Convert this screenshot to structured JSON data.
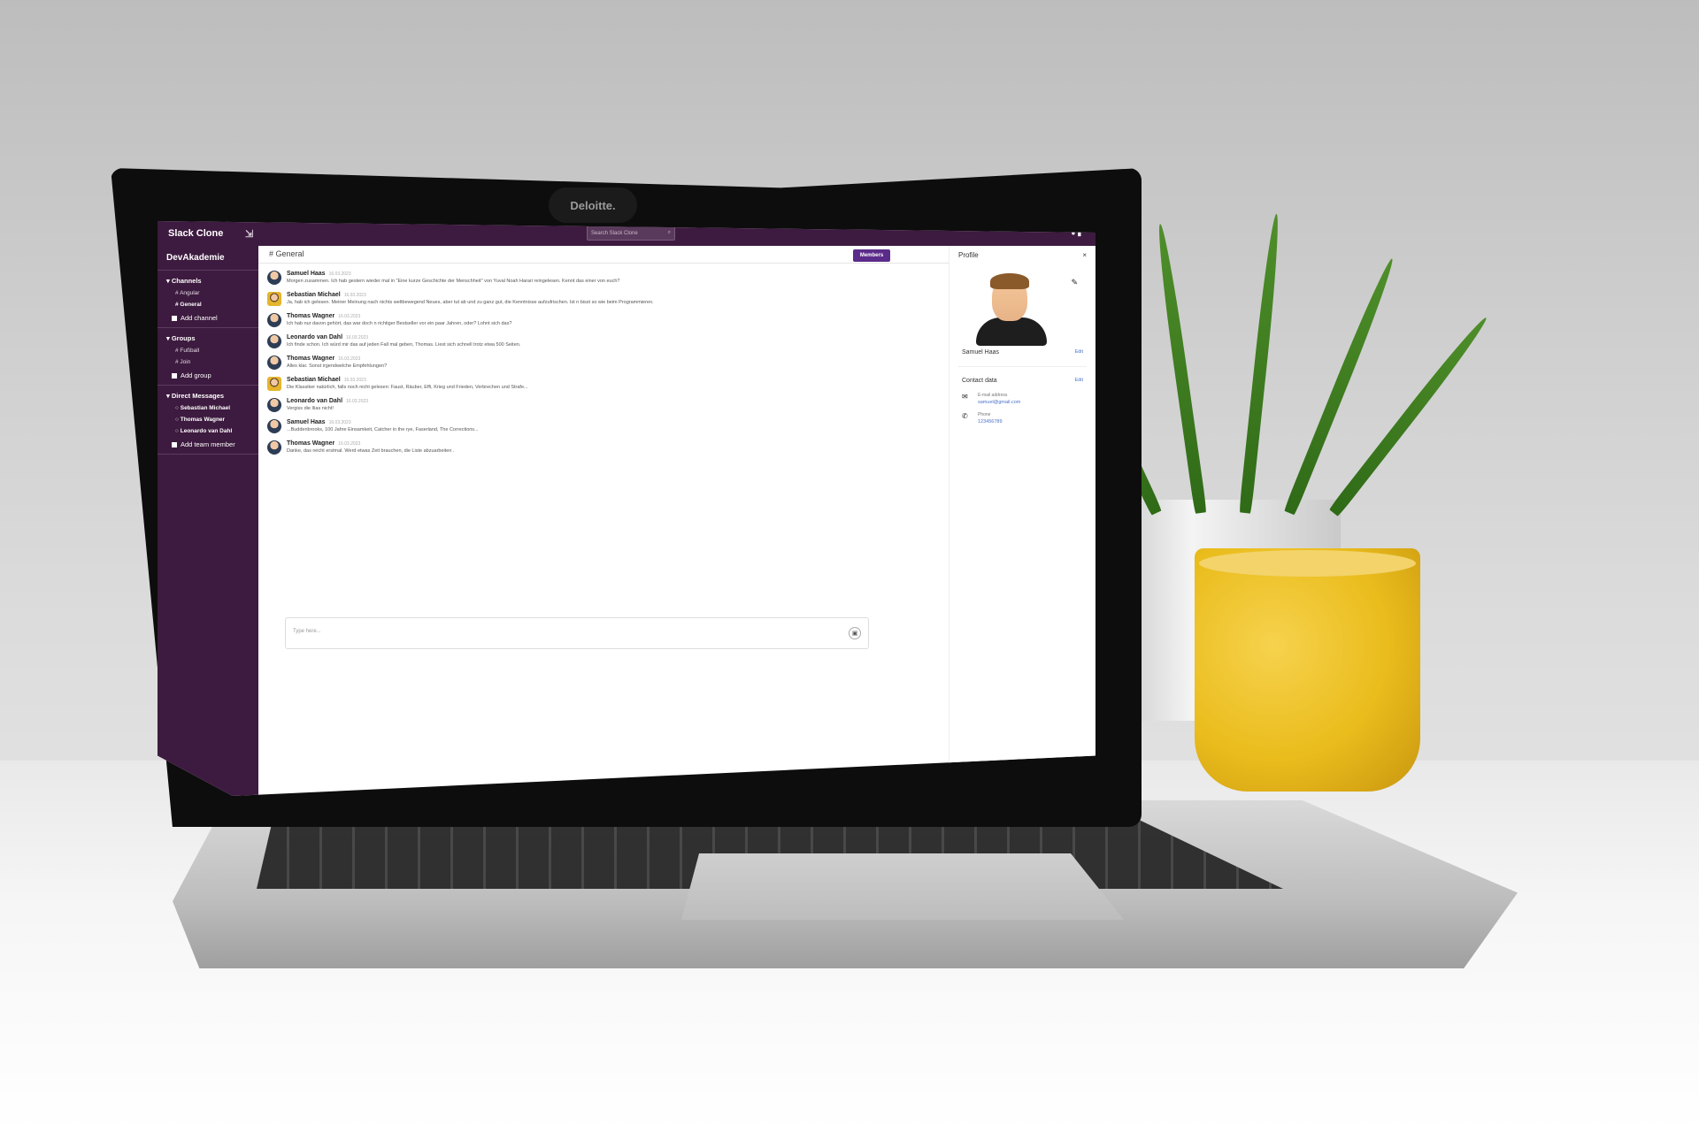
{
  "bezel": {
    "brand": "Deloitte."
  },
  "app": {
    "title": "Slack Clone",
    "collapse_icon": "collapse-arrows",
    "search_placeholder": "Search Slack Clone",
    "workspace": "DevAkademie"
  },
  "sidebar": {
    "channels_label": "▾ Channels",
    "channels": [
      "Angular",
      "General"
    ],
    "add_channel": "Add channel",
    "groups_label": "▾ Groups",
    "groups": [
      "Fußball",
      "Join"
    ],
    "add_group": "Add group",
    "dm_label": "▾ Direct Messages",
    "dms": [
      "Sebastian Michael",
      "Thomas Wagner",
      "Leonardo van Dahl"
    ],
    "add_member": "Add team member"
  },
  "channel": {
    "name": "# General",
    "members_button": "Members"
  },
  "messages": [
    {
      "author": "Samuel Haas",
      "date": "16.03.2023",
      "text": "Morgen zusammen. Ich hab gestern wieder mal in \"Eine kurze Geschichte der Menschheit\" von Yuval Noah Harari reingelesen. Kennt das einer von euch?",
      "alt": false
    },
    {
      "author": "Sebastian Michael",
      "date": "16.03.2023",
      "text": "Ja, hab ich gelesen. Meiner Meinung nach nichts weltbewegend Neues, aber tut ab und zu ganz gut, die Kenntnisse aufzufrischen. Ist n bisst so wie beim Programmieren.",
      "alt": true
    },
    {
      "author": "Thomas Wagner",
      "date": "16.03.2023",
      "text": "Ich hab nur davon gehört, das war doch n richtiger Bestseller vor ein paar Jahren, oder? Lohnt sich das?",
      "alt": false
    },
    {
      "author": "Leonardo van Dahl",
      "date": "16.03.2023",
      "text": "Ich finde schon. Ich würd mir das auf jeden Fall mal geben, Thomas. Liest sich schnell trotz etwa 500 Seiten.",
      "alt": false
    },
    {
      "author": "Thomas Wagner",
      "date": "16.03.2023",
      "text": "Alles klar. Sonst irgendwelche Empfehlungen?",
      "alt": false
    },
    {
      "author": "Sebastian Michael",
      "date": "16.03.2023",
      "text": "Die Klassiker natürlich, falls noch nicht gelesen: Faust, Räuber, Effi, Krieg und Frieden, Verbrechen und Strafe...",
      "alt": true
    },
    {
      "author": "Leonardo van Dahl",
      "date": "16.03.2023",
      "text": "Vergiss die Ilias nicht!",
      "alt": false
    },
    {
      "author": "Samuel Haas",
      "date": "16.03.2023",
      "text": "...Buddenbrooks, 100 Jahre Einsamkeit, Catcher in the rye, Faserland, The Corrections...",
      "alt": false
    },
    {
      "author": "Thomas Wagner",
      "date": "16.03.2023",
      "text": "Danke, das reicht erstmal. Werd etwas Zeit brauchen, die Liste abzuarbeiten .",
      "alt": false
    }
  ],
  "composer": {
    "placeholder": "Type here..."
  },
  "profile": {
    "title": "Profile",
    "close": "×",
    "name": "Samuel Haas",
    "edit": "Edit",
    "contact_title": "Contact data",
    "email_label": "E-mail address",
    "email": "samuel@gmail.com",
    "phone_label": "Phone",
    "phone": "123456789"
  }
}
